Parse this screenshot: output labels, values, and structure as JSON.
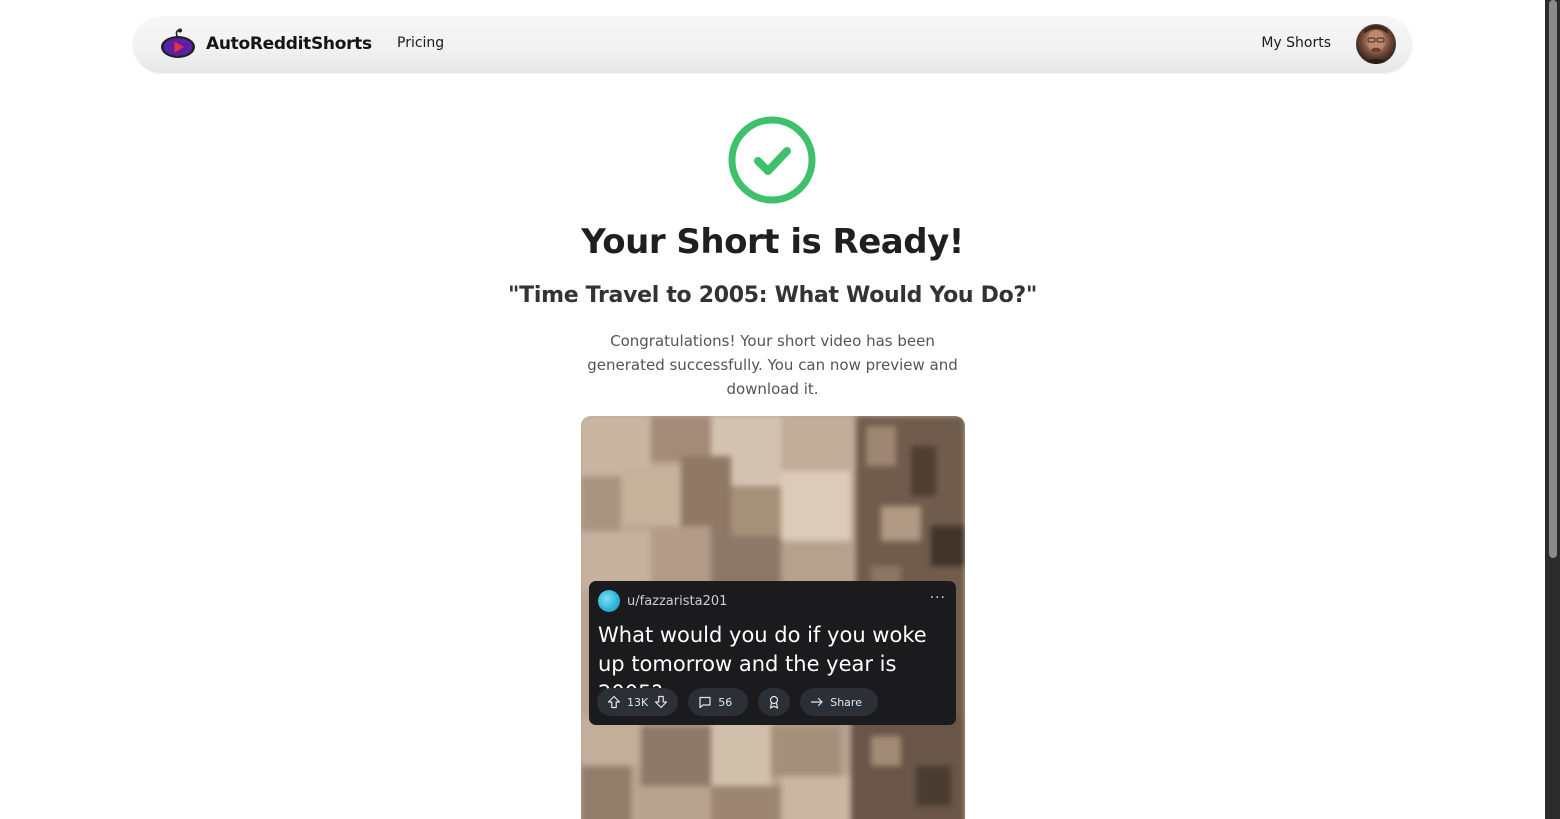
{
  "nav": {
    "brand_name": "AutoRedditShorts",
    "pricing_label": "Pricing",
    "my_shorts_label": "My Shorts"
  },
  "main": {
    "title": "Your Short is Ready!",
    "subtitle": "\"Time Travel to 2005: What Would You Do?\"",
    "message": "Congratulations! Your short video has been generated successfully. You can now preview and download it."
  },
  "video_preview": {
    "post": {
      "username": "u/fazzarista201",
      "more_label": "···",
      "title": "What would you do if you woke up tomorrow and the year is 2005?",
      "upvotes": "13K",
      "comments": "56",
      "share_label": "Share"
    }
  },
  "colors": {
    "success_green": "#3ec16c",
    "brand_purple": "#5b1fa8",
    "brand_red": "#e8333a",
    "card_bg": "#1b1b1e",
    "pill_bg": "#2b2f36"
  },
  "icons": {
    "logo": "reddit-play-logo",
    "success": "check-circle-icon",
    "upvote": "arrow-up-icon",
    "downvote": "arrow-down-icon",
    "comment": "comment-icon",
    "award": "award-icon",
    "share": "share-arrow-icon"
  }
}
